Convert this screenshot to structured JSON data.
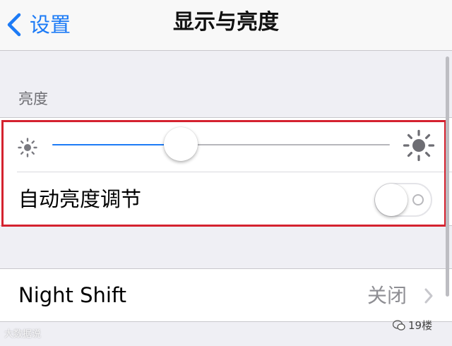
{
  "nav": {
    "back_label": "设置",
    "title": "显示与亮度"
  },
  "brightness_section": {
    "header": "亮度",
    "slider_level": 0.38,
    "auto_brightness": {
      "label": "自动亮度调节",
      "enabled": false
    }
  },
  "night_shift": {
    "label": "Night Shift",
    "value": "关闭"
  },
  "icons": {
    "back": "chevron-left-icon",
    "low_brightness": "sun-small-icon",
    "high_brightness": "sun-large-icon",
    "disclosure": "chevron-right-icon"
  },
  "colors": {
    "accent": "#1d7bf6",
    "highlight": "#d4222f",
    "background": "#efeff4"
  },
  "watermarks": {
    "left": "大数据说",
    "right": "19楼"
  }
}
